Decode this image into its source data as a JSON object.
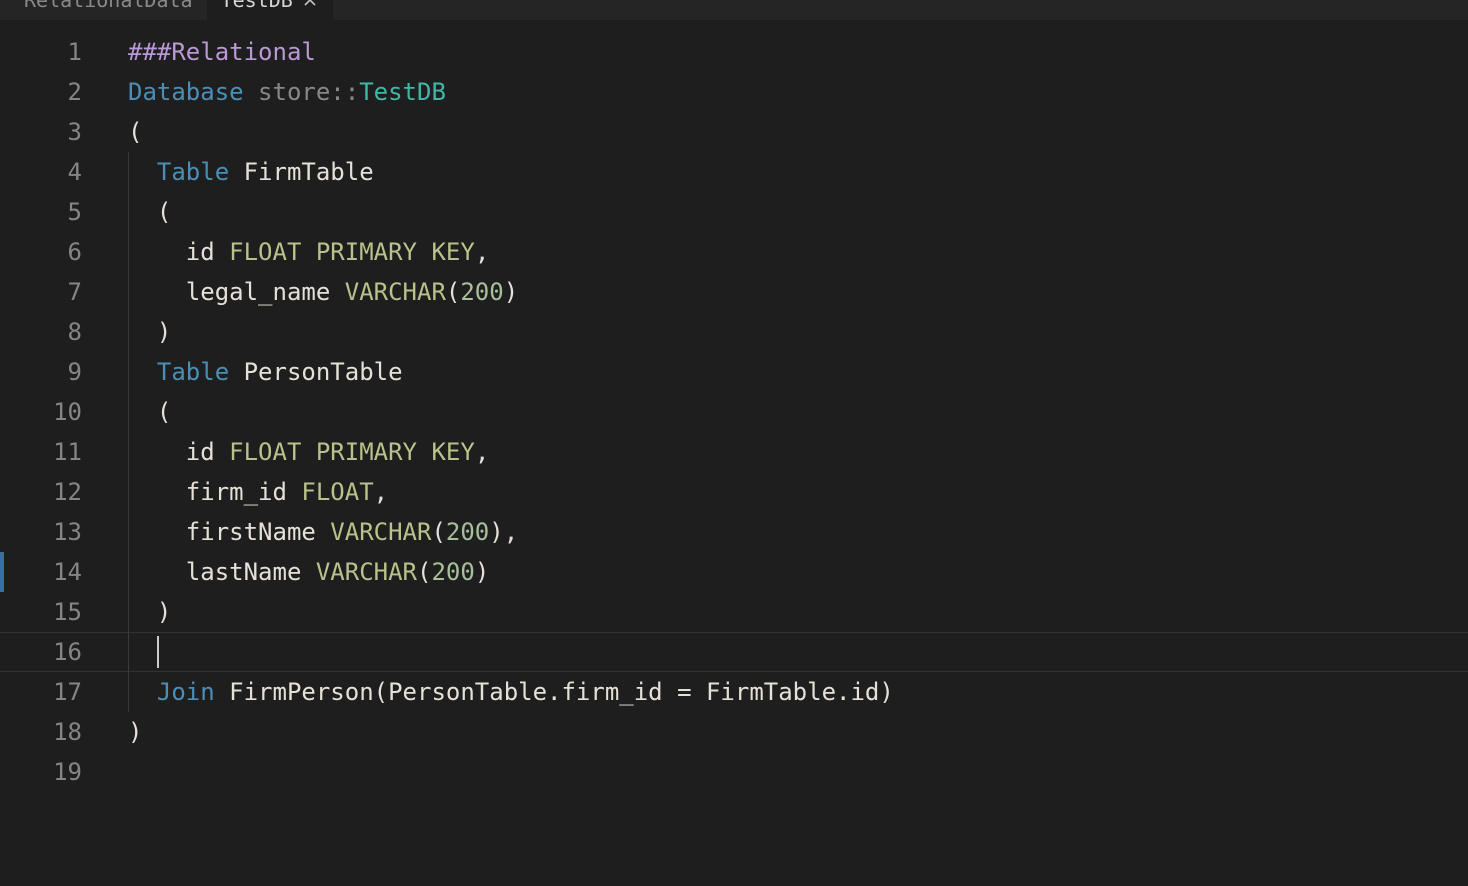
{
  "tabs": [
    {
      "label": "RelationalData",
      "active": false,
      "hasClose": false
    },
    {
      "label": "TestDB",
      "active": true,
      "hasClose": true
    }
  ],
  "editor": {
    "activeLine": 16,
    "cursorLineMarkerIndex": 13,
    "lines": [
      {
        "n": 1,
        "indent": 0,
        "tokens": [
          {
            "t": "###Relational",
            "c": "c-comment"
          }
        ]
      },
      {
        "n": 2,
        "indent": 0,
        "tokens": [
          {
            "t": "Database",
            "c": "c-kw"
          },
          {
            "t": " ",
            "c": ""
          },
          {
            "t": "store",
            "c": "c-ns"
          },
          {
            "t": "::",
            "c": "c-ns"
          },
          {
            "t": "TestDB",
            "c": "c-class"
          }
        ]
      },
      {
        "n": 3,
        "indent": 0,
        "tokens": [
          {
            "t": "(",
            "c": "c-text"
          }
        ]
      },
      {
        "n": 4,
        "indent": 1,
        "tokens": [
          {
            "t": "  ",
            "c": ""
          },
          {
            "t": "Table",
            "c": "c-kw"
          },
          {
            "t": " FirmTable",
            "c": "c-text"
          }
        ]
      },
      {
        "n": 5,
        "indent": 1,
        "tokens": [
          {
            "t": "  (",
            "c": "c-text"
          }
        ]
      },
      {
        "n": 6,
        "indent": 1,
        "tokens": [
          {
            "t": "    id ",
            "c": "c-text"
          },
          {
            "t": "FLOAT",
            "c": "c-key"
          },
          {
            "t": " ",
            "c": ""
          },
          {
            "t": "PRIMARY",
            "c": "c-key"
          },
          {
            "t": " ",
            "c": ""
          },
          {
            "t": "KEY",
            "c": "c-key"
          },
          {
            "t": ",",
            "c": "c-text"
          }
        ]
      },
      {
        "n": 7,
        "indent": 1,
        "tokens": [
          {
            "t": "    legal_name ",
            "c": "c-text"
          },
          {
            "t": "VARCHAR",
            "c": "c-key"
          },
          {
            "t": "(",
            "c": "c-text"
          },
          {
            "t": "200",
            "c": "c-num"
          },
          {
            "t": ")",
            "c": "c-text"
          }
        ]
      },
      {
        "n": 8,
        "indent": 1,
        "tokens": [
          {
            "t": "  )",
            "c": "c-text"
          }
        ]
      },
      {
        "n": 9,
        "indent": 1,
        "tokens": [
          {
            "t": "  ",
            "c": ""
          },
          {
            "t": "Table",
            "c": "c-kw"
          },
          {
            "t": " PersonTable",
            "c": "c-text"
          }
        ]
      },
      {
        "n": 10,
        "indent": 1,
        "tokens": [
          {
            "t": "  (",
            "c": "c-text"
          }
        ]
      },
      {
        "n": 11,
        "indent": 1,
        "tokens": [
          {
            "t": "    id ",
            "c": "c-text"
          },
          {
            "t": "FLOAT",
            "c": "c-key"
          },
          {
            "t": " ",
            "c": ""
          },
          {
            "t": "PRIMARY",
            "c": "c-key"
          },
          {
            "t": " ",
            "c": ""
          },
          {
            "t": "KEY",
            "c": "c-key"
          },
          {
            "t": ",",
            "c": "c-text"
          }
        ]
      },
      {
        "n": 12,
        "indent": 1,
        "tokens": [
          {
            "t": "    firm_id ",
            "c": "c-text"
          },
          {
            "t": "FLOAT",
            "c": "c-key"
          },
          {
            "t": ",",
            "c": "c-text"
          }
        ]
      },
      {
        "n": 13,
        "indent": 1,
        "tokens": [
          {
            "t": "    firstName ",
            "c": "c-text"
          },
          {
            "t": "VARCHAR",
            "c": "c-key"
          },
          {
            "t": "(",
            "c": "c-text"
          },
          {
            "t": "200",
            "c": "c-num"
          },
          {
            "t": "),",
            "c": "c-text"
          }
        ]
      },
      {
        "n": 14,
        "indent": 1,
        "tokens": [
          {
            "t": "    lastName ",
            "c": "c-text"
          },
          {
            "t": "VARCHAR",
            "c": "c-key"
          },
          {
            "t": "(",
            "c": "c-text"
          },
          {
            "t": "200",
            "c": "c-num"
          },
          {
            "t": ")",
            "c": "c-text"
          }
        ]
      },
      {
        "n": 15,
        "indent": 1,
        "tokens": [
          {
            "t": "  )",
            "c": "c-text"
          }
        ]
      },
      {
        "n": 16,
        "indent": 1,
        "tokens": []
      },
      {
        "n": 17,
        "indent": 1,
        "tokens": [
          {
            "t": "  ",
            "c": ""
          },
          {
            "t": "Join",
            "c": "c-kw"
          },
          {
            "t": " FirmPerson(PersonTable.firm_id = FirmTable.id)",
            "c": "c-text"
          }
        ]
      },
      {
        "n": 18,
        "indent": 0,
        "tokens": [
          {
            "t": ")",
            "c": "c-text"
          }
        ]
      },
      {
        "n": 19,
        "indent": 0,
        "tokens": []
      }
    ]
  }
}
